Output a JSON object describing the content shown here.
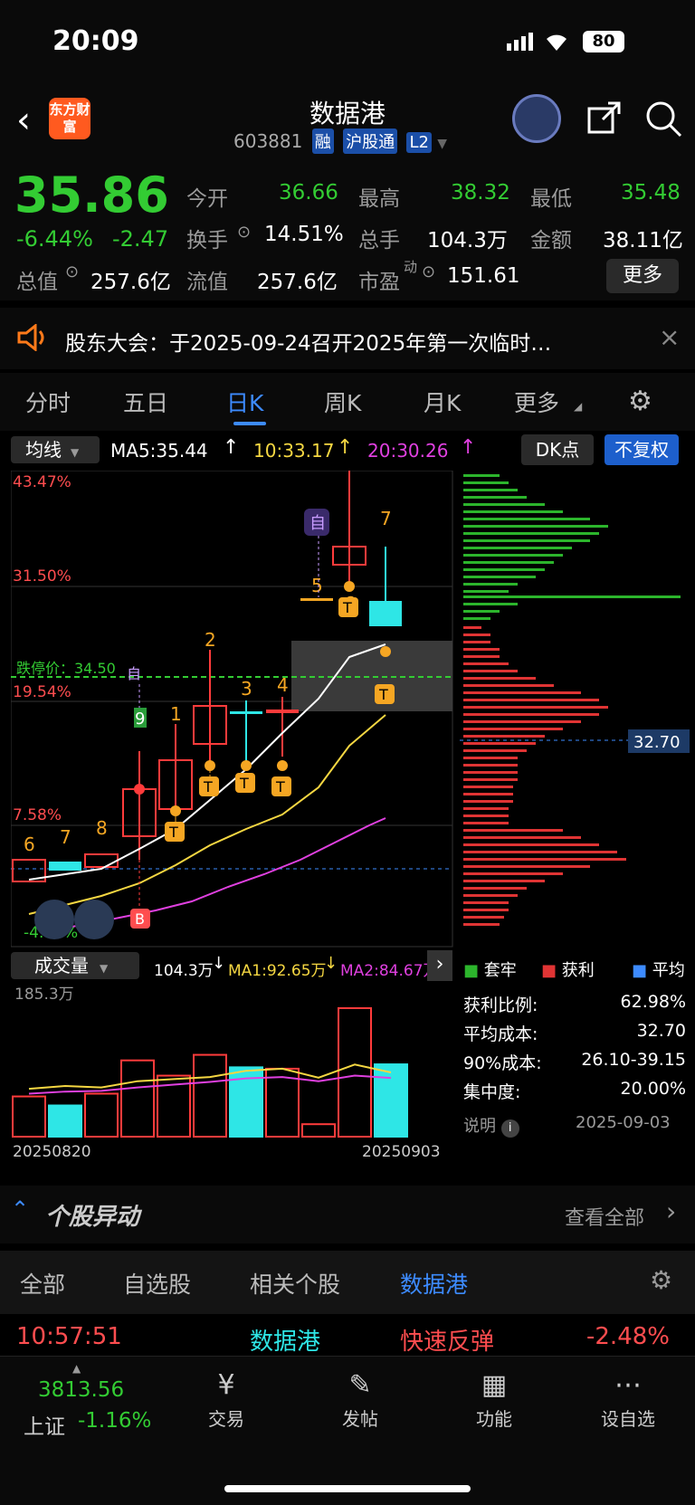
{
  "status": {
    "time": "20:09",
    "battery": "80"
  },
  "header": {
    "title": "数据港",
    "code": "603881",
    "badges": [
      "融",
      "沪股通",
      "L2"
    ],
    "logo": "东方财富"
  },
  "quote": {
    "price": "35.86",
    "pct": "-6.44%",
    "chg": "-2.47",
    "labels": {
      "open": "今开",
      "high": "最高",
      "low": "最低",
      "turnover": "换手",
      "volume": "总手",
      "amount": "金额",
      "mcap": "总值",
      "float": "流值",
      "pe": "市盈",
      "pe_sup": "动"
    },
    "open": "36.66",
    "high": "38.32",
    "low": "35.48",
    "turnover": "14.51%",
    "volume": "104.3万",
    "amount": "38.11亿",
    "mcap": "257.6亿",
    "float": "257.6亿",
    "pe": "151.61",
    "more": "更多"
  },
  "notice": {
    "text": "股东大会：于2025-09-24召开2025年第一次临时…"
  },
  "tabs": [
    "分时",
    "五日",
    "日K",
    "周K",
    "月K",
    "更多"
  ],
  "chart_toolbar": {
    "ma_select": "均线",
    "ma5": "MA5:35.44",
    "ma10": "10:33.17",
    "ma20": "20:30.26",
    "dk": "DK点",
    "fq": "不复权"
  },
  "kline": {
    "y_labels": [
      "43.47%",
      "31.50%",
      "19.54%",
      "7.58%",
      "-4.39%"
    ],
    "limit_down": "跌停价：34.50",
    "cost_label": "32.70",
    "marks": [
      "6",
      "7",
      "8",
      "9",
      "1",
      "2",
      "3",
      "4",
      "5",
      "6",
      "7",
      "自",
      "自"
    ],
    "chips": [
      "T",
      "T",
      "T",
      "T",
      "T",
      "T",
      "T"
    ],
    "b_mark": "B"
  },
  "chart_data": [
    {
      "type": "candlestick",
      "title": "日K",
      "x": [
        "20250820",
        "",
        "",
        "",
        "",
        "",
        "",
        "",
        "",
        "",
        "20250903"
      ],
      "series": [
        {
          "name": "MA5",
          "values": [
            27.5,
            27.8,
            28.3,
            29.5,
            31.0,
            32.4,
            33.3,
            34.0,
            35.2,
            35.9,
            35.44
          ]
        },
        {
          "name": "MA10",
          "values": [
            26.8,
            27.0,
            27.3,
            27.9,
            28.6,
            29.4,
            30.2,
            31.0,
            31.8,
            32.6,
            33.17
          ]
        },
        {
          "name": "MA20",
          "values": [
            25.9,
            26.1,
            26.3,
            26.6,
            27.0,
            27.4,
            27.9,
            28.4,
            28.9,
            29.6,
            30.26
          ]
        }
      ]
    },
    {
      "type": "bar",
      "title": "成交量",
      "categories": [
        "20250820",
        "",
        "",
        "",
        "",
        "",
        "",
        "",
        "",
        "",
        "20250903"
      ],
      "values": [
        58,
        45,
        62,
        110,
        88,
        118,
        100,
        98,
        18,
        185.3,
        104.3
      ],
      "series": [
        {
          "name": "MA1",
          "values": [
            69,
            73,
            71,
            80,
            83,
            86,
            95,
            98,
            85,
            104,
            92.65
          ]
        },
        {
          "name": "MA2",
          "values": [
            62,
            65,
            66,
            71,
            75,
            79,
            84,
            86,
            80,
            88,
            84.67
          ]
        }
      ],
      "ylabel": "185.3万",
      "xlim": [
        "20250820",
        "20250903"
      ]
    }
  ],
  "volume": {
    "select": "成交量",
    "vol": "104.3万",
    "ma1": "MA1:92.65万",
    "ma2": "MA2:84.67万",
    "max": "185.3万",
    "date_start": "20250820",
    "date_end": "20250903"
  },
  "chip_stats": {
    "legend": [
      "套牢",
      "获利",
      "平均"
    ],
    "rows": [
      {
        "k": "获利比例:",
        "v": "62.98%"
      },
      {
        "k": "平均成本:",
        "v": "32.70"
      },
      {
        "k": "90%成本:",
        "v": "26.10-39.15"
      },
      {
        "k": "集中度:",
        "v": "20.00%"
      }
    ],
    "note": "说明",
    "date": "2025-09-03"
  },
  "movement": {
    "title": "个股异动",
    "view_all": "查看全部",
    "tabs": [
      "全部",
      "自选股",
      "相关个股",
      "数据港"
    ],
    "row": {
      "time": "10:57:51",
      "name": "数据港",
      "event": "快速反弹",
      "pct": "-2.48%"
    }
  },
  "nav": {
    "index_value": "3813.56",
    "index_name": "上证",
    "index_pct": "-1.16%",
    "items": [
      "交易",
      "发帖",
      "功能",
      "设自选"
    ]
  }
}
